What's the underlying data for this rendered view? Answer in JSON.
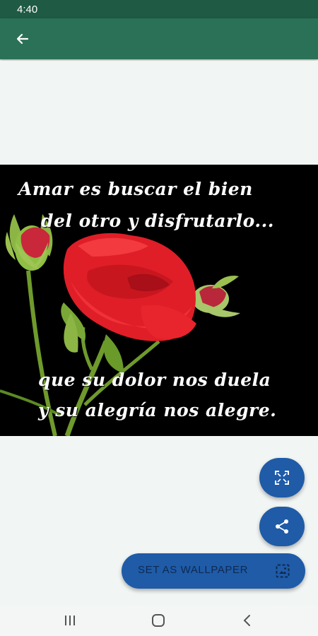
{
  "status_bar": {
    "time": "4:40"
  },
  "app_bar": {
    "back_icon": "arrow-left-icon"
  },
  "wallpaper": {
    "quote_lines": [
      "Amar es buscar el bien",
      "del otro y disfrutarlo...",
      "que su dolor nos duela",
      "y su alegría nos alegre."
    ]
  },
  "actions": {
    "fullscreen_icon": "fullscreen-icon",
    "share_icon": "share-icon",
    "set_wallpaper_label": "SET AS WALLPAPER",
    "set_wallpaper_icon": "wallpaper-icon"
  },
  "nav": {
    "recent_icon": "recent-apps-icon",
    "home_icon": "home-icon",
    "back_icon": "back-chevron-icon"
  },
  "colors": {
    "status_bar": "#1e5a44",
    "app_bar": "#2b7158",
    "fab": "#1f5ba7",
    "background": "#f1f5f3"
  }
}
